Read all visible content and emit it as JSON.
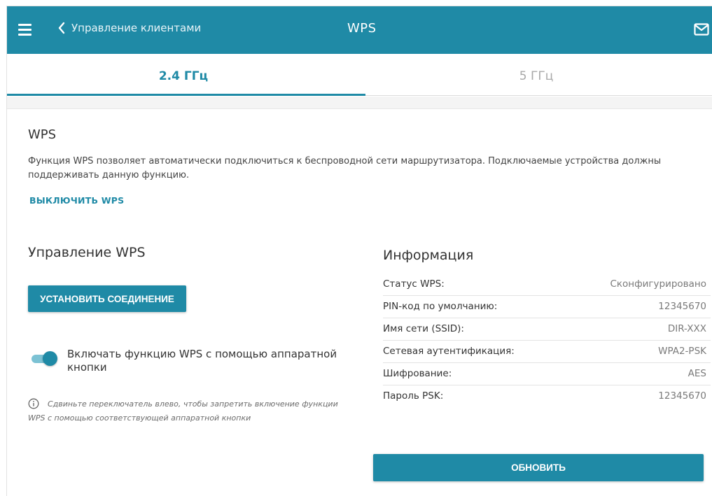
{
  "header": {
    "back_label": "Управление клиентами",
    "title": "WPS",
    "menu_icon": "hamburger-menu-icon",
    "mail_icon": "mail-icon"
  },
  "tabs": [
    {
      "label": "2.4 ГГц",
      "active": true
    },
    {
      "label": "5 ГГц",
      "active": false
    }
  ],
  "wps": {
    "title": "WPS",
    "description": "Функция WPS позволяет автоматически подключиться к беспроводной сети маршрутизатора. Подключаемые устройства должны поддерживать данную функцию.",
    "disable_link": "ВЫКЛЮЧИТЬ WPS"
  },
  "management": {
    "title": "Управление WPS",
    "connect_button": "УСТАНОВИТЬ СОЕДИНЕНИЕ",
    "hw_toggle_label": "Включать функцию WPS с помощью аппаратной кнопки",
    "hw_toggle_on": true,
    "hint": "Сдвиньте переключатель влево, чтобы запретить включение функции WPS с помощью соответствующей аппаратной кнопки"
  },
  "info": {
    "title": "Информация",
    "rows": [
      {
        "key": "Статус WPS:",
        "value": "Сконфигурировано"
      },
      {
        "key": "PIN-код по умолчанию:",
        "value": "12345670"
      },
      {
        "key": "Имя сети (SSID):",
        "value": "DIR-XXX"
      },
      {
        "key": "Сетевая аутентификация:",
        "value": "WPA2-PSK"
      },
      {
        "key": "Шифрование:",
        "value": "AES"
      },
      {
        "key": "Пароль PSK:",
        "value": "12345670"
      }
    ],
    "refresh_button": "ОБНОВИТЬ"
  },
  "colors": {
    "accent": "#1f8aa6",
    "toggle_track": "#7cc2d4"
  }
}
